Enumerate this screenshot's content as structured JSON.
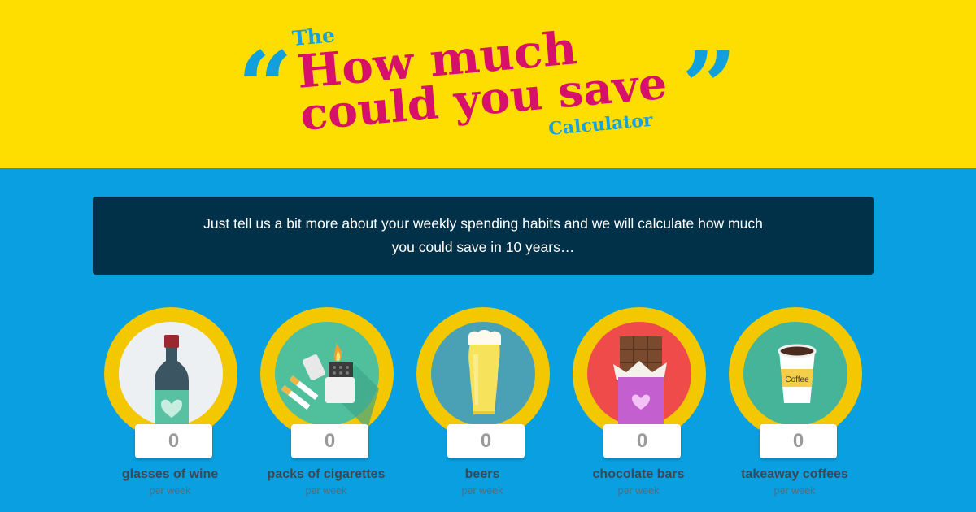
{
  "header": {
    "open_quote": "“",
    "close_quote": "”",
    "title_the": "The",
    "title_line1": "How much",
    "title_line2": "could you save",
    "title_calculator": "Calculator"
  },
  "intro": {
    "text": "Just tell us a bit more about your weekly spending habits and we will calculate how much you could save in 10 years…"
  },
  "items": [
    {
      "count": "0",
      "label": "glasses of wine",
      "sub": "per week",
      "icon": "wine-bottle-icon"
    },
    {
      "count": "0",
      "label": "packs of cigarettes",
      "sub": "per week",
      "icon": "lighter-cigarettes-icon"
    },
    {
      "count": "0",
      "label": "beers",
      "sub": "per week",
      "icon": "beer-glass-icon"
    },
    {
      "count": "0",
      "label": "chocolate bars",
      "sub": "per week",
      "icon": "chocolate-bar-icon"
    },
    {
      "count": "0",
      "label": "takeaway coffees",
      "sub": "per week",
      "icon": "coffee-cup-icon",
      "cup_text": "Coffee"
    }
  ],
  "colors": {
    "banner": "#fede00",
    "background": "#0a9fe0",
    "intro_box": "#003148",
    "title_pink": "#d6106b",
    "title_blue": "#1aa0dc",
    "ring": "#f3c800"
  }
}
